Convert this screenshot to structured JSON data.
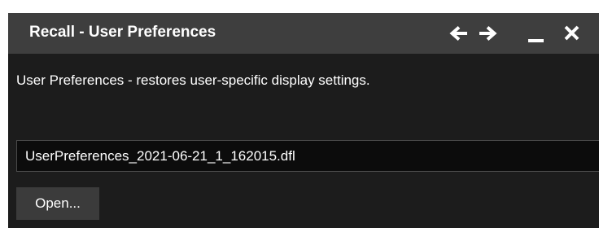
{
  "window": {
    "title": "Recall - User Preferences",
    "controls": [
      "arrow-left-icon",
      "arrow-right-icon",
      "minimize-icon",
      "close-icon"
    ]
  },
  "content": {
    "description": "User Preferences - restores user-specific display settings.",
    "file_value": "UserPreferences_2021-06-21_1_162015.dfl",
    "open_label": "Open..."
  },
  "colors": {
    "titlebar": "#3e3e3e",
    "background": "#1c1c1c",
    "field": "#0c0c0c",
    "button": "#3b3b3b",
    "text": "#ffffff"
  }
}
